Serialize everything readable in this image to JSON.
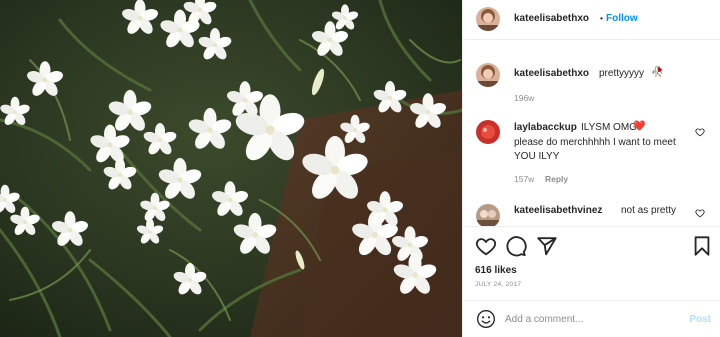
{
  "header": {
    "username": "kateelisabethxo",
    "separator": "•",
    "follow_label": "Follow"
  },
  "comments": [
    {
      "username": "kateelisabethxo",
      "text": "prettyyyyy",
      "emoji": "🥀",
      "time": "196w",
      "reply_label": ""
    },
    {
      "username": "laylabacckup",
      "text": "ILYSM OMG",
      "emoji": "❤️",
      "text2": "please do merchhhhh I want to meet YOU ILYY",
      "time": "157w",
      "reply_label": "Reply"
    },
    {
      "username": "kateelisabethvinez",
      "text": "not as pretty",
      "time": "",
      "reply_label": ""
    }
  ],
  "actions": {
    "like_icon": "heart-icon",
    "comment_icon": "comment-icon",
    "share_icon": "share-icon",
    "save_icon": "bookmark-icon"
  },
  "likes": "616 likes",
  "date": "JULY 24, 2017",
  "add_comment": {
    "placeholder": "Add a comment...",
    "post_label": "Post",
    "emoji_icon": "smiley-icon"
  },
  "colors": {
    "link": "#0095f6",
    "muted": "#8e8e8e",
    "post_disabled": "#b2dffc",
    "heart_red": "#ed4956"
  }
}
